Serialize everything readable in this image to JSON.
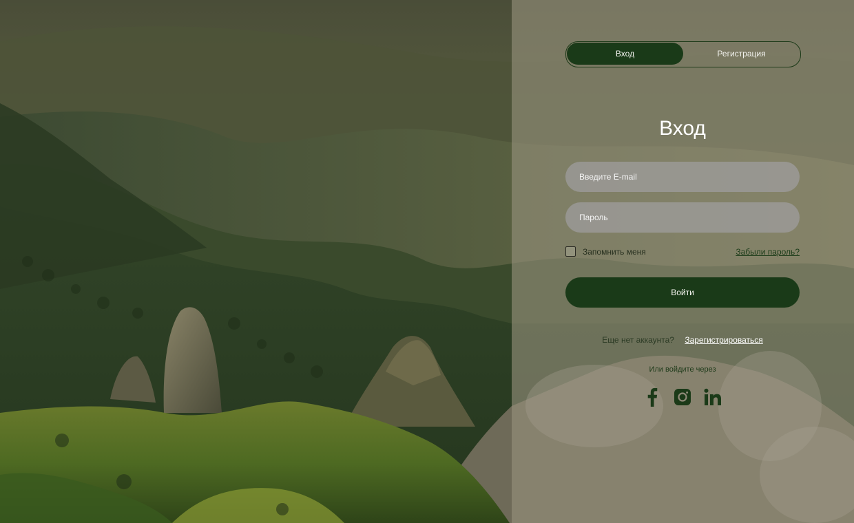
{
  "tabs": {
    "login_label": "Вход",
    "register_label": "Регистрация",
    "active": "login"
  },
  "form": {
    "title": "Вход",
    "email_placeholder": "Введите E-mail",
    "password_placeholder": "Пароль",
    "remember_label": "Запомнить меня",
    "remember_checked": false,
    "forgot_label": "Забыли пароль?",
    "submit_label": "Войти"
  },
  "signup": {
    "prompt": "Еще нет аккаунта?",
    "link_label": "Зарегистрироваться"
  },
  "social": {
    "prompt": "Или войдите через",
    "icons": [
      "facebook-icon",
      "instagram-icon",
      "linkedin-icon"
    ]
  },
  "colors": {
    "accent": "#1a3a18",
    "panel_overlay": "#96917d",
    "field_bg": "#a09ea0"
  }
}
